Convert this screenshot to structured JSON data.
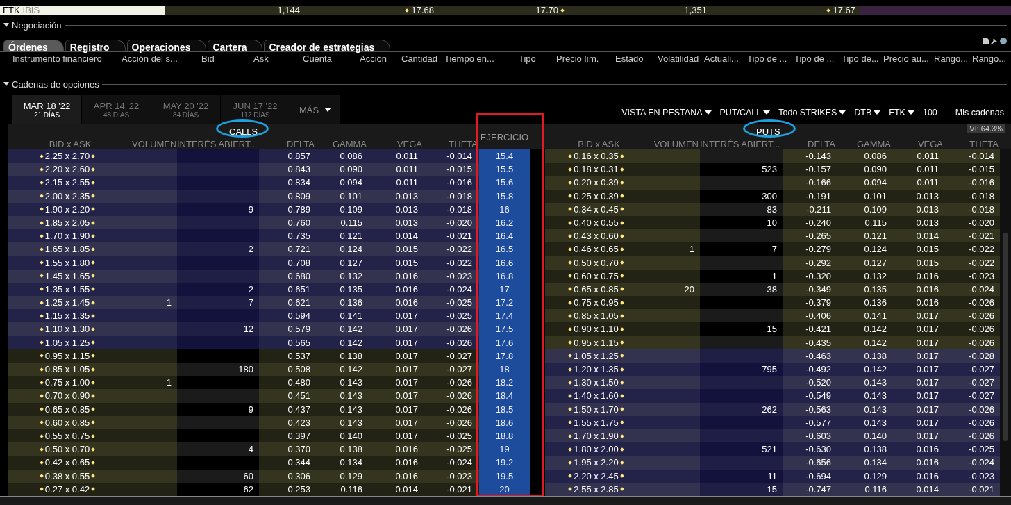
{
  "quote_bar": {
    "symbol": "FTK",
    "exchange": "IBIS",
    "bid_size": "1,144",
    "bid": "17.68",
    "ask": "17.70",
    "ask_size": "1,351",
    "last": "17.67"
  },
  "trading": {
    "title": "Negociación",
    "tabs": [
      {
        "label": "Órdenes",
        "selected": true
      },
      {
        "label": "Registro",
        "selected": false
      },
      {
        "label": "Operaciones",
        "selected": false
      },
      {
        "label": "Cartera",
        "selected": false
      },
      {
        "label": "Creador de estrategias",
        "selected": false
      }
    ],
    "columns": [
      "Instrumento financiero",
      "Acción del s...",
      "Bid",
      "Ask",
      "Cuenta",
      "Acción",
      "Cantidad",
      "Tiempo en...",
      "Tipo",
      "Precio lím.",
      "Estado",
      "Volatilidad",
      "Actuali...",
      "Tipo de ...",
      "Tipo de ...",
      "Tipo de...",
      "Precio au...",
      "Rango...",
      "Rango..."
    ]
  },
  "option_chains": {
    "title": "Cadenas de opciones",
    "expiries": [
      {
        "date": "MAR 18 '22",
        "days": "21 DÍAS",
        "selected": true
      },
      {
        "date": "APR 14 '22",
        "days": "48 DÍAS",
        "selected": false
      },
      {
        "date": "MAY 20 '22",
        "days": "84 DÍAS",
        "selected": false
      },
      {
        "date": "JUN 17 '22",
        "days": "112 DÍAS",
        "selected": false
      }
    ],
    "more": "MÁS",
    "controls": [
      {
        "label": "VISTA EN PESTAÑA",
        "dropdown": true
      },
      {
        "label": "PUT/CALL",
        "dropdown": true
      },
      {
        "label": "Todo STRIKES",
        "dropdown": true
      },
      {
        "label": "DTB",
        "dropdown": true
      },
      {
        "label": "FTK",
        "dropdown": true
      },
      {
        "label": "100",
        "dropdown": false
      },
      {
        "label": "Mis cadenas",
        "dropdown": false
      }
    ],
    "implied_volatility": "VI: 64.3%",
    "calls_title": "CALLS",
    "strike_title": "EJERCICIO",
    "puts_title": "PUTS",
    "call_columns": [
      "BID x ASK",
      "VOLUMEN",
      "INTERÉS ABIERT...",
      "DELTA",
      "GAMMA",
      "VEGA",
      "THETA"
    ],
    "put_columns": [
      "BID x ASK",
      "VOLUMEN",
      "INTERÉS ABIERT...",
      "DELTA",
      "GAMMA",
      "VEGA",
      "THETA"
    ],
    "rows": [
      {
        "strike": "15.4",
        "call": {
          "itm": true,
          "bid_ask": "2.25 x 2.70",
          "delta": "0.857",
          "gamma": "0.086",
          "vega": "0.011",
          "theta": "-0.014"
        },
        "put": {
          "itm": false,
          "bid_ask": "0.16 x 0.35",
          "delta": "-0.143",
          "gamma": "0.086",
          "vega": "0.011",
          "theta": "-0.014"
        }
      },
      {
        "strike": "15.5",
        "call": {
          "itm": true,
          "bid_ask": "2.20 x 2.60",
          "delta": "0.843",
          "gamma": "0.090",
          "vega": "0.011",
          "theta": "-0.015"
        },
        "put": {
          "itm": false,
          "bid_ask": "0.18 x 0.31",
          "open_interest": "523",
          "delta": "-0.157",
          "gamma": "0.090",
          "vega": "0.011",
          "theta": "-0.015"
        }
      },
      {
        "strike": "15.6",
        "call": {
          "itm": true,
          "bid_ask": "2.15 x 2.55",
          "delta": "0.834",
          "gamma": "0.094",
          "vega": "0.011",
          "theta": "-0.016"
        },
        "put": {
          "itm": false,
          "bid_ask": "0.20 x 0.39",
          "delta": "-0.166",
          "gamma": "0.094",
          "vega": "0.011",
          "theta": "-0.016"
        }
      },
      {
        "strike": "15.8",
        "call": {
          "itm": true,
          "bid_ask": "2.00 x 2.35",
          "delta": "0.809",
          "gamma": "0.101",
          "vega": "0.013",
          "theta": "-0.018"
        },
        "put": {
          "itm": false,
          "bid_ask": "0.25 x 0.39",
          "open_interest": "300",
          "delta": "-0.191",
          "gamma": "0.101",
          "vega": "0.013",
          "theta": "-0.018"
        }
      },
      {
        "strike": "16",
        "call": {
          "itm": true,
          "bid_ask": "1.90 x 2.20",
          "open_interest": "9",
          "delta": "0.789",
          "gamma": "0.109",
          "vega": "0.013",
          "theta": "-0.018"
        },
        "put": {
          "itm": false,
          "bid_ask": "0.34 x 0.45",
          "open_interest": "83",
          "delta": "-0.211",
          "gamma": "0.109",
          "vega": "0.013",
          "theta": "-0.018"
        }
      },
      {
        "strike": "16.2",
        "call": {
          "itm": true,
          "bid_ask": "1.85 x 2.05",
          "delta": "0.760",
          "gamma": "0.115",
          "vega": "0.013",
          "theta": "-0.020"
        },
        "put": {
          "itm": false,
          "bid_ask": "0.40 x 0.55",
          "open_interest": "10",
          "delta": "-0.240",
          "gamma": "0.115",
          "vega": "0.013",
          "theta": "-0.020"
        }
      },
      {
        "strike": "16.4",
        "call": {
          "itm": true,
          "bid_ask": "1.70 x 1.90",
          "delta": "0.735",
          "gamma": "0.121",
          "vega": "0.014",
          "theta": "-0.021"
        },
        "put": {
          "itm": false,
          "bid_ask": "0.43 x 0.60",
          "delta": "-0.265",
          "gamma": "0.121",
          "vega": "0.014",
          "theta": "-0.021"
        }
      },
      {
        "strike": "16.5",
        "call": {
          "itm": true,
          "bid_ask": "1.65 x 1.85",
          "open_interest": "2",
          "delta": "0.721",
          "gamma": "0.124",
          "vega": "0.015",
          "theta": "-0.022"
        },
        "put": {
          "itm": false,
          "bid_ask": "0.46 x 0.65",
          "volume": "1",
          "open_interest": "7",
          "delta": "-0.279",
          "gamma": "0.124",
          "vega": "0.015",
          "theta": "-0.022"
        }
      },
      {
        "strike": "16.6",
        "call": {
          "itm": true,
          "bid_ask": "1.55 x 1.80",
          "delta": "0.708",
          "gamma": "0.127",
          "vega": "0.015",
          "theta": "-0.022"
        },
        "put": {
          "itm": false,
          "bid_ask": "0.50 x 0.70",
          "delta": "-0.292",
          "gamma": "0.127",
          "vega": "0.015",
          "theta": "-0.022"
        }
      },
      {
        "strike": "16.8",
        "call": {
          "itm": true,
          "bid_ask": "1.45 x 1.65",
          "delta": "0.680",
          "gamma": "0.132",
          "vega": "0.016",
          "theta": "-0.023"
        },
        "put": {
          "itm": false,
          "bid_ask": "0.60 x 0.75",
          "open_interest": "1",
          "delta": "-0.320",
          "gamma": "0.132",
          "vega": "0.016",
          "theta": "-0.023"
        }
      },
      {
        "strike": "17",
        "call": {
          "itm": true,
          "bid_ask": "1.35 x 1.55",
          "open_interest": "2",
          "delta": "0.651",
          "gamma": "0.135",
          "vega": "0.016",
          "theta": "-0.024"
        },
        "put": {
          "itm": false,
          "bid_ask": "0.65 x 0.85",
          "volume": "20",
          "open_interest": "38",
          "delta": "-0.349",
          "gamma": "0.135",
          "vega": "0.016",
          "theta": "-0.024"
        }
      },
      {
        "strike": "17.2",
        "call": {
          "itm": true,
          "bid_ask": "1.25 x 1.45",
          "volume": "1",
          "open_interest": "7",
          "delta": "0.621",
          "gamma": "0.136",
          "vega": "0.016",
          "theta": "-0.025"
        },
        "put": {
          "itm": false,
          "bid_ask": "0.75 x 0.95",
          "delta": "-0.379",
          "gamma": "0.136",
          "vega": "0.016",
          "theta": "-0.026"
        }
      },
      {
        "strike": "17.4",
        "call": {
          "itm": true,
          "bid_ask": "1.15 x 1.35",
          "delta": "0.594",
          "gamma": "0.141",
          "vega": "0.017",
          "theta": "-0.025"
        },
        "put": {
          "itm": false,
          "bid_ask": "0.85 x 1.05",
          "delta": "-0.406",
          "gamma": "0.141",
          "vega": "0.017",
          "theta": "-0.026"
        }
      },
      {
        "strike": "17.5",
        "call": {
          "itm": true,
          "bid_ask": "1.10 x 1.30",
          "open_interest": "12",
          "delta": "0.579",
          "gamma": "0.142",
          "vega": "0.017",
          "theta": "-0.026"
        },
        "put": {
          "itm": false,
          "bid_ask": "0.90 x 1.10",
          "open_interest": "15",
          "delta": "-0.421",
          "gamma": "0.142",
          "vega": "0.017",
          "theta": "-0.026"
        }
      },
      {
        "strike": "17.6",
        "call": {
          "itm": true,
          "bid_ask": "1.05 x 1.25",
          "delta": "0.565",
          "gamma": "0.142",
          "vega": "0.017",
          "theta": "-0.026"
        },
        "put": {
          "itm": false,
          "bid_ask": "0.95 x 1.15",
          "delta": "-0.435",
          "gamma": "0.142",
          "vega": "0.017",
          "theta": "-0.026"
        }
      },
      {
        "strike": "17.8",
        "call": {
          "itm": false,
          "bid_ask": "0.95 x 1.15",
          "delta": "0.537",
          "gamma": "0.138",
          "vega": "0.017",
          "theta": "-0.027"
        },
        "put": {
          "itm": true,
          "bid_ask": "1.05 x 1.25",
          "delta": "-0.463",
          "gamma": "0.138",
          "vega": "0.017",
          "theta": "-0.028"
        }
      },
      {
        "strike": "18",
        "call": {
          "itm": false,
          "bid_ask": "0.85 x 1.05",
          "open_interest": "180",
          "delta": "0.508",
          "gamma": "0.142",
          "vega": "0.017",
          "theta": "-0.027"
        },
        "put": {
          "itm": true,
          "bid_ask": "1.20 x 1.35",
          "open_interest": "795",
          "delta": "-0.492",
          "gamma": "0.142",
          "vega": "0.017",
          "theta": "-0.027"
        }
      },
      {
        "strike": "18.2",
        "call": {
          "itm": false,
          "bid_ask": "0.75 x 1.00",
          "volume": "1",
          "delta": "0.480",
          "gamma": "0.143",
          "vega": "0.017",
          "theta": "-0.026"
        },
        "put": {
          "itm": true,
          "bid_ask": "1.30 x 1.50",
          "delta": "-0.520",
          "gamma": "0.143",
          "vega": "0.017",
          "theta": "-0.027"
        }
      },
      {
        "strike": "18.4",
        "call": {
          "itm": false,
          "bid_ask": "0.70 x 0.90",
          "delta": "0.451",
          "gamma": "0.143",
          "vega": "0.017",
          "theta": "-0.026"
        },
        "put": {
          "itm": true,
          "bid_ask": "1.40 x 1.60",
          "delta": "-0.549",
          "gamma": "0.143",
          "vega": "0.017",
          "theta": "-0.027"
        }
      },
      {
        "strike": "18.5",
        "call": {
          "itm": false,
          "bid_ask": "0.65 x 0.85",
          "open_interest": "9",
          "delta": "0.437",
          "gamma": "0.143",
          "vega": "0.017",
          "theta": "-0.026"
        },
        "put": {
          "itm": true,
          "bid_ask": "1.50 x 1.70",
          "open_interest": "262",
          "delta": "-0.563",
          "gamma": "0.143",
          "vega": "0.017",
          "theta": "-0.026"
        }
      },
      {
        "strike": "18.6",
        "call": {
          "itm": false,
          "bid_ask": "0.60 x 0.85",
          "delta": "0.423",
          "gamma": "0.143",
          "vega": "0.017",
          "theta": "-0.026"
        },
        "put": {
          "itm": true,
          "bid_ask": "1.55 x 1.75",
          "delta": "-0.577",
          "gamma": "0.143",
          "vega": "0.017",
          "theta": "-0.026"
        }
      },
      {
        "strike": "18.8",
        "call": {
          "itm": false,
          "bid_ask": "0.55 x 0.75",
          "delta": "0.397",
          "gamma": "0.140",
          "vega": "0.017",
          "theta": "-0.025"
        },
        "put": {
          "itm": true,
          "bid_ask": "1.70 x 1.90",
          "delta": "-0.603",
          "gamma": "0.140",
          "vega": "0.017",
          "theta": "-0.026"
        }
      },
      {
        "strike": "19",
        "call": {
          "itm": false,
          "bid_ask": "0.50 x 0.70",
          "open_interest": "4",
          "delta": "0.370",
          "gamma": "0.138",
          "vega": "0.016",
          "theta": "-0.025"
        },
        "put": {
          "itm": true,
          "bid_ask": "1.80 x 2.00",
          "open_interest": "521",
          "delta": "-0.630",
          "gamma": "0.138",
          "vega": "0.016",
          "theta": "-0.025"
        }
      },
      {
        "strike": "19.2",
        "call": {
          "itm": false,
          "bid_ask": "0.42 x 0.65",
          "delta": "0.344",
          "gamma": "0.134",
          "vega": "0.016",
          "theta": "-0.024"
        },
        "put": {
          "itm": true,
          "bid_ask": "1.95 x 2.20",
          "delta": "-0.656",
          "gamma": "0.134",
          "vega": "0.016",
          "theta": "-0.024"
        }
      },
      {
        "strike": "19.5",
        "call": {
          "itm": false,
          "bid_ask": "0.38 x 0.55",
          "open_interest": "60",
          "delta": "0.306",
          "gamma": "0.129",
          "vega": "0.016",
          "theta": "-0.023"
        },
        "put": {
          "itm": true,
          "bid_ask": "2.20 x 2.45",
          "open_interest": "11",
          "delta": "-0.694",
          "gamma": "0.129",
          "vega": "0.016",
          "theta": "-0.023"
        }
      },
      {
        "strike": "20",
        "call": {
          "itm": false,
          "bid_ask": "0.27 x 0.42",
          "open_interest": "62",
          "delta": "0.253",
          "gamma": "0.116",
          "vega": "0.014",
          "theta": "-0.021"
        },
        "put": {
          "itm": true,
          "bid_ask": "2.55 x 2.85",
          "open_interest": "15",
          "delta": "-0.747",
          "gamma": "0.116",
          "vega": "0.014",
          "theta": "-0.021"
        }
      }
    ]
  }
}
